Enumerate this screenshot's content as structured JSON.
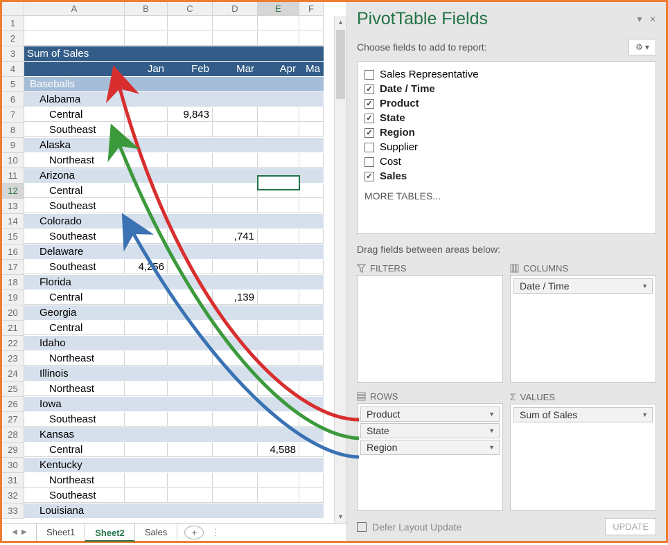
{
  "columns": [
    "A",
    "B",
    "C",
    "D",
    "E",
    "F"
  ],
  "title": "Sum of Sales",
  "months": [
    "Jan",
    "Feb",
    "Mar",
    "Apr",
    "Ma"
  ],
  "rows": [
    {
      "n": 1,
      "type": "blank"
    },
    {
      "n": 2,
      "type": "blank"
    },
    {
      "n": 3,
      "type": "title"
    },
    {
      "n": 4,
      "type": "months"
    },
    {
      "n": 5,
      "type": "product",
      "label": "Baseballs"
    },
    {
      "n": 6,
      "type": "state",
      "label": "Alabama"
    },
    {
      "n": 7,
      "type": "region",
      "label": "Central",
      "vals": {
        "Feb": "9,843"
      }
    },
    {
      "n": 8,
      "type": "region",
      "label": "Southeast",
      "vals": {}
    },
    {
      "n": 9,
      "type": "state",
      "label": "Alaska"
    },
    {
      "n": 10,
      "type": "region",
      "label": "Northeast",
      "vals": {}
    },
    {
      "n": 11,
      "type": "state",
      "label": "Arizona"
    },
    {
      "n": 12,
      "type": "region",
      "label": "Central",
      "vals": {},
      "activerow": true
    },
    {
      "n": 13,
      "type": "region",
      "label": "Southeast",
      "vals": {}
    },
    {
      "n": 14,
      "type": "state",
      "label": "Colorado"
    },
    {
      "n": 15,
      "type": "region",
      "label": "Southeast",
      "vals": {
        "Mar": ",741"
      }
    },
    {
      "n": 16,
      "type": "state",
      "label": "Delaware"
    },
    {
      "n": 17,
      "type": "region",
      "label": "Southeast",
      "vals": {
        "Jan": "4,256"
      }
    },
    {
      "n": 18,
      "type": "state",
      "label": "Florida"
    },
    {
      "n": 19,
      "type": "region",
      "label": "Central",
      "vals": {
        "Mar": ",139"
      }
    },
    {
      "n": 20,
      "type": "state",
      "label": "Georgia"
    },
    {
      "n": 21,
      "type": "region",
      "label": "Central",
      "vals": {}
    },
    {
      "n": 22,
      "type": "state",
      "label": "Idaho"
    },
    {
      "n": 23,
      "type": "region",
      "label": "Northeast",
      "vals": {}
    },
    {
      "n": 24,
      "type": "state",
      "label": "Illinois"
    },
    {
      "n": 25,
      "type": "region",
      "label": "Northeast",
      "vals": {}
    },
    {
      "n": 26,
      "type": "state",
      "label": "Iowa"
    },
    {
      "n": 27,
      "type": "region",
      "label": "Southeast",
      "vals": {}
    },
    {
      "n": 28,
      "type": "state",
      "label": "Kansas"
    },
    {
      "n": 29,
      "type": "region",
      "label": "Central",
      "vals": {
        "Apr": "4,588"
      }
    },
    {
      "n": 30,
      "type": "state",
      "label": "Kentucky"
    },
    {
      "n": 31,
      "type": "region",
      "label": "Northeast",
      "vals": {}
    },
    {
      "n": 32,
      "type": "region",
      "label": "Southeast",
      "vals": {}
    },
    {
      "n": 33,
      "type": "state",
      "label": "Louisiana"
    }
  ],
  "tabs": {
    "items": [
      "Sheet1",
      "Sheet2",
      "Sales"
    ],
    "active": 1
  },
  "panel": {
    "title": "PivotTable Fields",
    "subtitle": "Choose fields to add to report:",
    "fields": [
      {
        "label": "Sales Representative",
        "checked": false
      },
      {
        "label": "Date / Time",
        "checked": true
      },
      {
        "label": "Product",
        "checked": true
      },
      {
        "label": "State",
        "checked": true
      },
      {
        "label": "Region",
        "checked": true
      },
      {
        "label": "Supplier",
        "checked": false
      },
      {
        "label": "Cost",
        "checked": false
      },
      {
        "label": "Sales",
        "checked": true
      }
    ],
    "more": "MORE TABLES...",
    "drag": "Drag fields between areas below:",
    "area_labels": {
      "filters": "FILTERS",
      "columns": "COLUMNS",
      "rows": "ROWS",
      "values": "VALUES"
    },
    "areas": {
      "filters": [],
      "columns": [
        "Date / Time"
      ],
      "rows": [
        "Product",
        "State",
        "Region"
      ],
      "values": [
        "Sum of Sales"
      ]
    },
    "defer": "Defer Layout Update",
    "update": "UPDATE"
  },
  "colors": {
    "accent": "#217346"
  }
}
